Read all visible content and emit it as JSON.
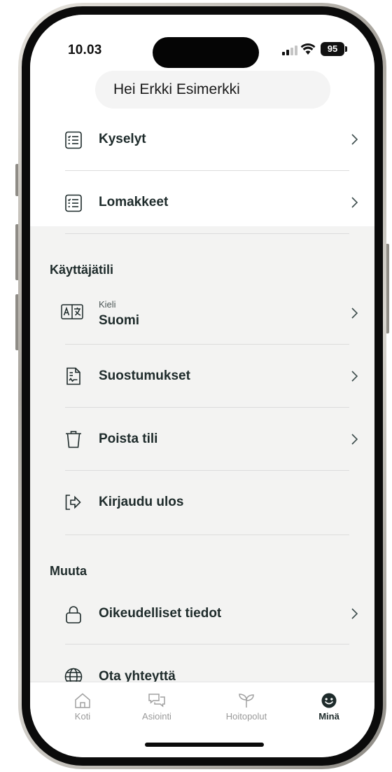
{
  "status_bar": {
    "time": "10.03",
    "battery": "95"
  },
  "greeting": "Hei Erkki Esimerkki",
  "top_items": [
    {
      "label": "Kyselyt",
      "icon": "list-icon"
    },
    {
      "label": "Lomakkeet",
      "icon": "list-icon"
    }
  ],
  "account": {
    "title": "Käyttäjätili",
    "language": {
      "label": "Kieli",
      "value": "Suomi",
      "icon": "translate-icon"
    },
    "items": [
      {
        "label": "Suostumukset",
        "icon": "document-icon"
      },
      {
        "label": "Poista tili",
        "icon": "trash-icon"
      },
      {
        "label": "Kirjaudu ulos",
        "icon": "logout-icon"
      }
    ]
  },
  "other": {
    "title": "Muuta",
    "items": [
      {
        "label": "Oikeudelliset tiedot",
        "icon": "lock-icon"
      },
      {
        "label": "Ota yhteyttä",
        "icon": "globe-icon"
      }
    ]
  },
  "nav": {
    "items": [
      {
        "label": "Koti",
        "icon": "home-icon"
      },
      {
        "label": "Asiointi",
        "icon": "chat-icon"
      },
      {
        "label": "Hoitopolut",
        "icon": "sprout-icon"
      },
      {
        "label": "Minä",
        "icon": "smiley-icon"
      }
    ],
    "active": "Minä"
  },
  "colors": {
    "text": "#1e2b2b",
    "section_bg": "#f3f3f2",
    "inactive_nav": "#9a9a9a"
  }
}
